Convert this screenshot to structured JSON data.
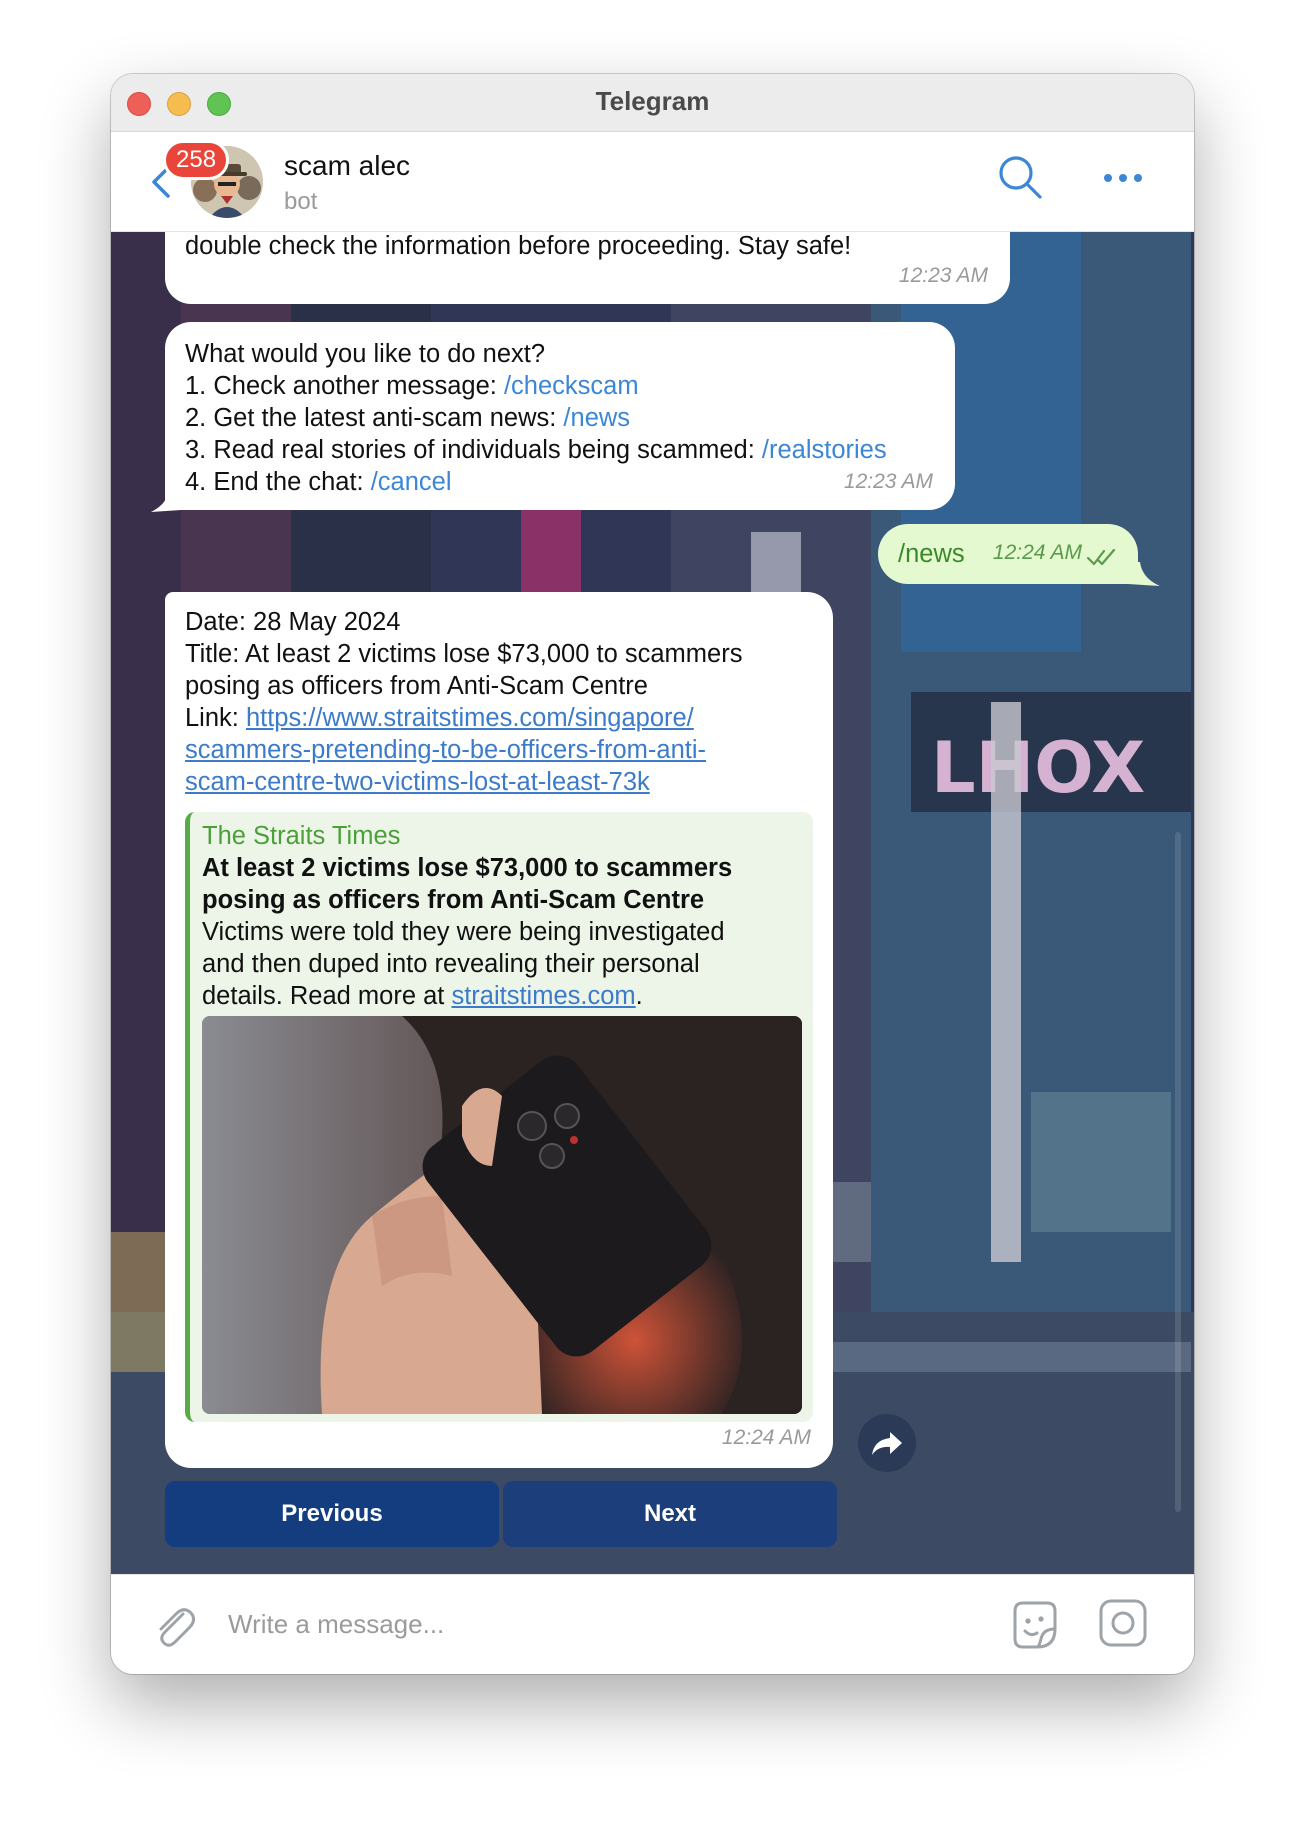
{
  "window": {
    "title": "Telegram"
  },
  "header": {
    "unread_count": "258",
    "chat_name": "scam alec",
    "chat_subtitle": "bot"
  },
  "messages": {
    "m1": {
      "text": "double check the information before proceeding. Stay safe!",
      "time": "12:23 AM"
    },
    "m2": {
      "intro": "What would you like to do next?",
      "items": [
        {
          "prefix": "1. Check another message: ",
          "command": "/checkscam"
        },
        {
          "prefix": "2. Get the latest anti-scam news: ",
          "command": "/news"
        },
        {
          "prefix": "3. Read real stories of individuals being scammed: ",
          "command": "/realstories"
        },
        {
          "prefix": "4. End the chat: ",
          "command": "/cancel"
        }
      ],
      "time": "12:23 AM"
    },
    "m3": {
      "text": "/news",
      "time": "12:24 AM"
    },
    "m4": {
      "date_line": "Date: 28 May 2024",
      "title_line_1": "Title: At least 2 victims lose $73,000 to scammers",
      "title_line_2": "posing as officers from Anti-Scam Centre",
      "link_label": "Link: ",
      "link_line_1": "https://www.straitstimes.com/singapore/",
      "link_line_2": "scammers-pretending-to-be-officers-from-anti-",
      "link_line_3": "scam-centre-two-victims-lost-at-least-73k",
      "preview": {
        "site": "The Straits Times",
        "title_1": "At least 2 victims lose $73,000 to scammers",
        "title_2": "posing as officers from Anti-Scam Centre",
        "desc_1": "Victims were told they were being investigated",
        "desc_2": "and then duped into revealing their personal",
        "desc_3": "details. Read more at ",
        "desc_link": "straitstimes.com",
        "desc_end": "."
      },
      "time": "12:24 AM"
    }
  },
  "keyboard": {
    "previous_label": "Previous",
    "next_label": "Next"
  },
  "composer": {
    "placeholder": "Write a message..."
  },
  "colors": {
    "accent": "#3b87d6",
    "outgoing_bubble": "#e4f9cf",
    "badge": "#e9453a",
    "link_preview_bar": "#58ab44",
    "keyboard_button": "#103c82"
  }
}
